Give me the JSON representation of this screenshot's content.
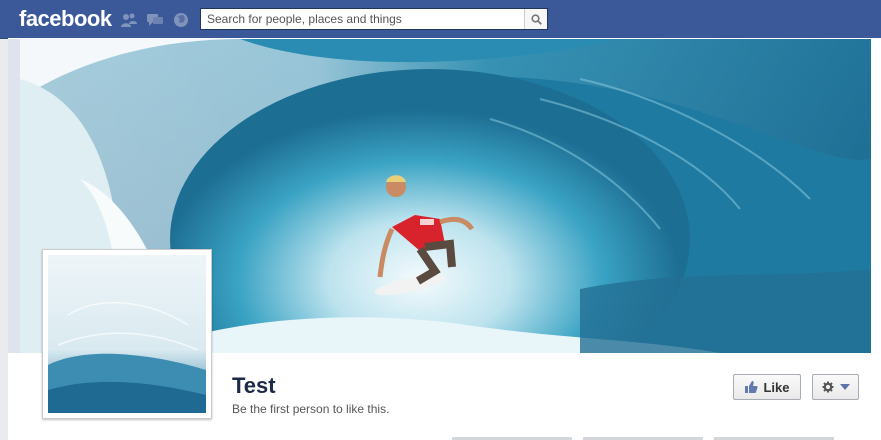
{
  "header": {
    "logo_text": "facebook",
    "jewels": [
      "friends-icon",
      "messages-icon",
      "notifications-globe-icon"
    ],
    "search": {
      "placeholder": "Search for people, places and things",
      "value": ""
    }
  },
  "page": {
    "name": "Test",
    "like_summary": "Be the first person to like this.",
    "like_button_label": "Like",
    "settings_icon": "gear-icon"
  },
  "colors": {
    "brand_blue": "#3b5998",
    "name_color": "#1c2a47"
  }
}
